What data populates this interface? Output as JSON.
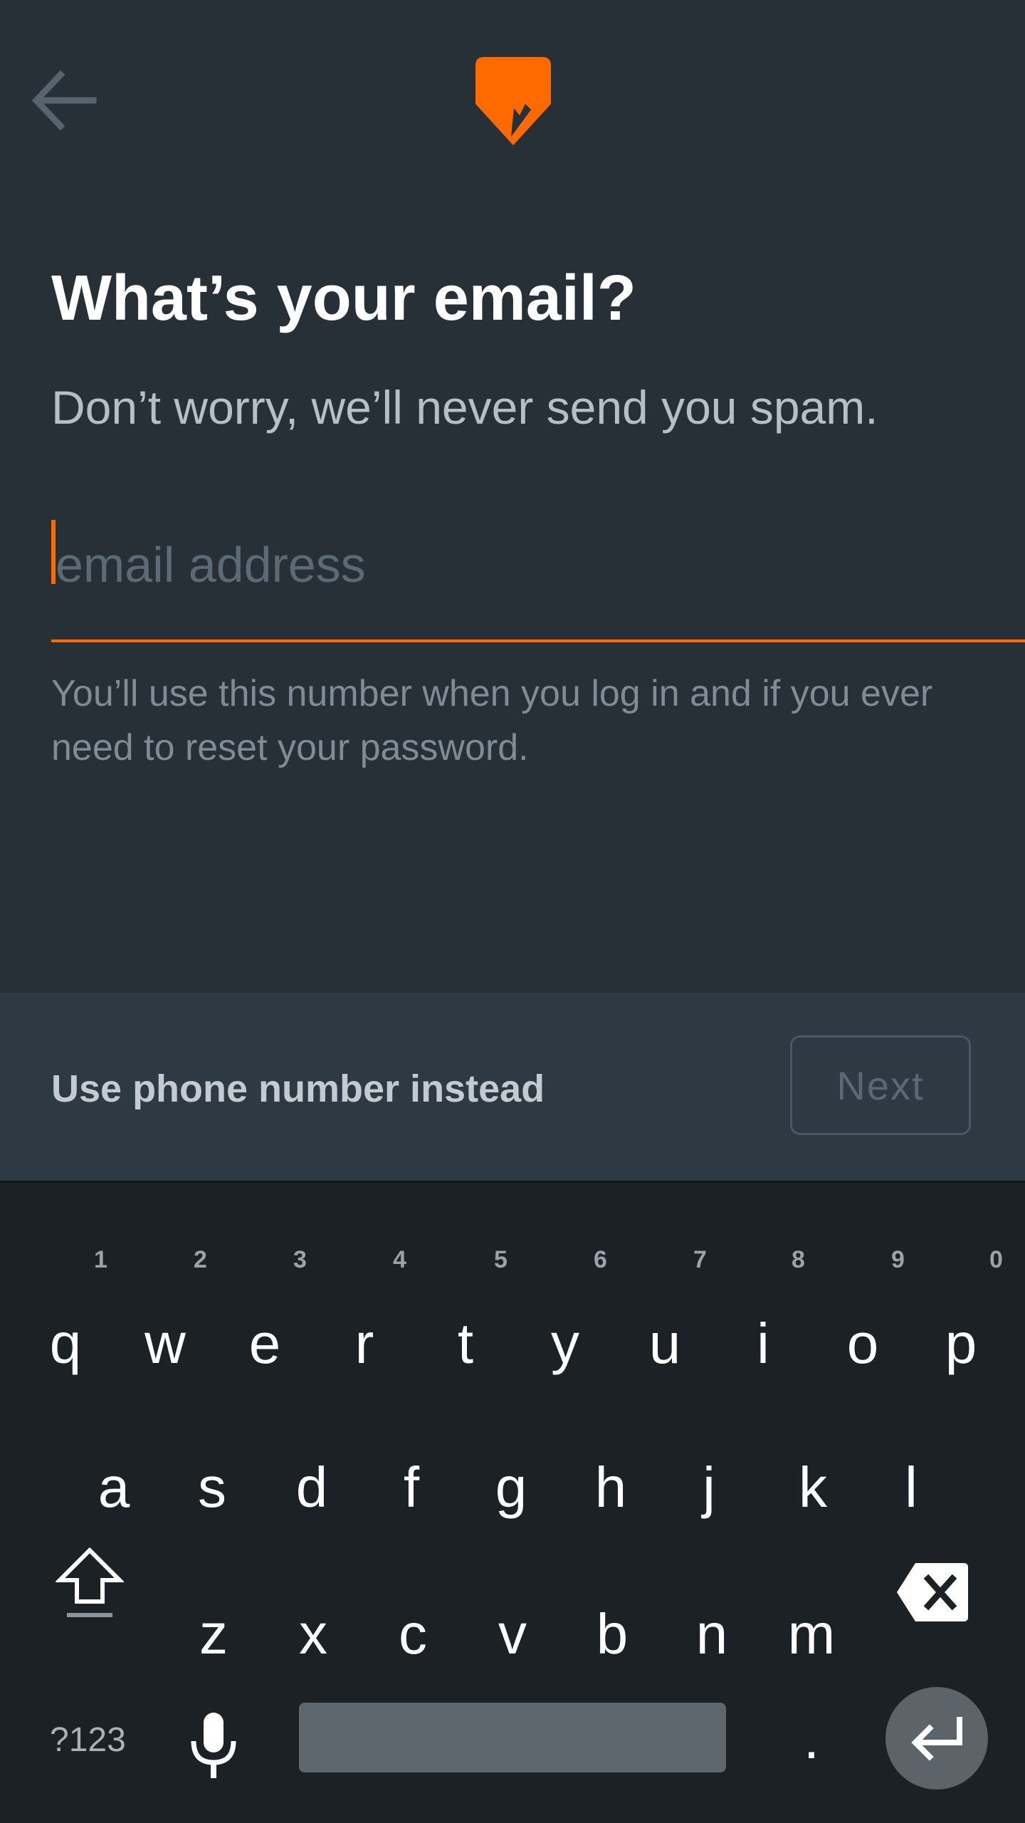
{
  "header": {
    "back_icon": "arrow-left-icon",
    "logo_icon": "orange-pin-logo"
  },
  "content": {
    "title": "What’s your email?",
    "subtitle": "Don’t worry, we’ll never send you spam.",
    "email_placeholder": "email address",
    "email_value": "",
    "helper_text": "You’ll use this number when you log in and if you ever need to reset your password."
  },
  "action_bar": {
    "alt_link": "Use phone number instead",
    "next_label": "Next"
  },
  "keyboard": {
    "row1": [
      "q",
      "w",
      "e",
      "r",
      "t",
      "y",
      "u",
      "i",
      "o",
      "p"
    ],
    "row1_hints": [
      "1",
      "2",
      "3",
      "4",
      "5",
      "6",
      "7",
      "8",
      "9",
      "0"
    ],
    "row2": [
      "a",
      "s",
      "d",
      "f",
      "g",
      "h",
      "j",
      "k",
      "l"
    ],
    "row3": [
      "z",
      "x",
      "c",
      "v",
      "b",
      "n",
      "m"
    ],
    "symbols_label": "?123",
    "period_label": ".",
    "shift_icon": "shift-arrow-icon",
    "delete_icon": "backspace-icon",
    "mic_icon": "microphone-icon",
    "enter_icon": "enter-icon"
  },
  "colors": {
    "background": "#272f37",
    "accent": "#ff6a00",
    "action_bar": "#2d3943",
    "keyboard": "#1b2125"
  }
}
